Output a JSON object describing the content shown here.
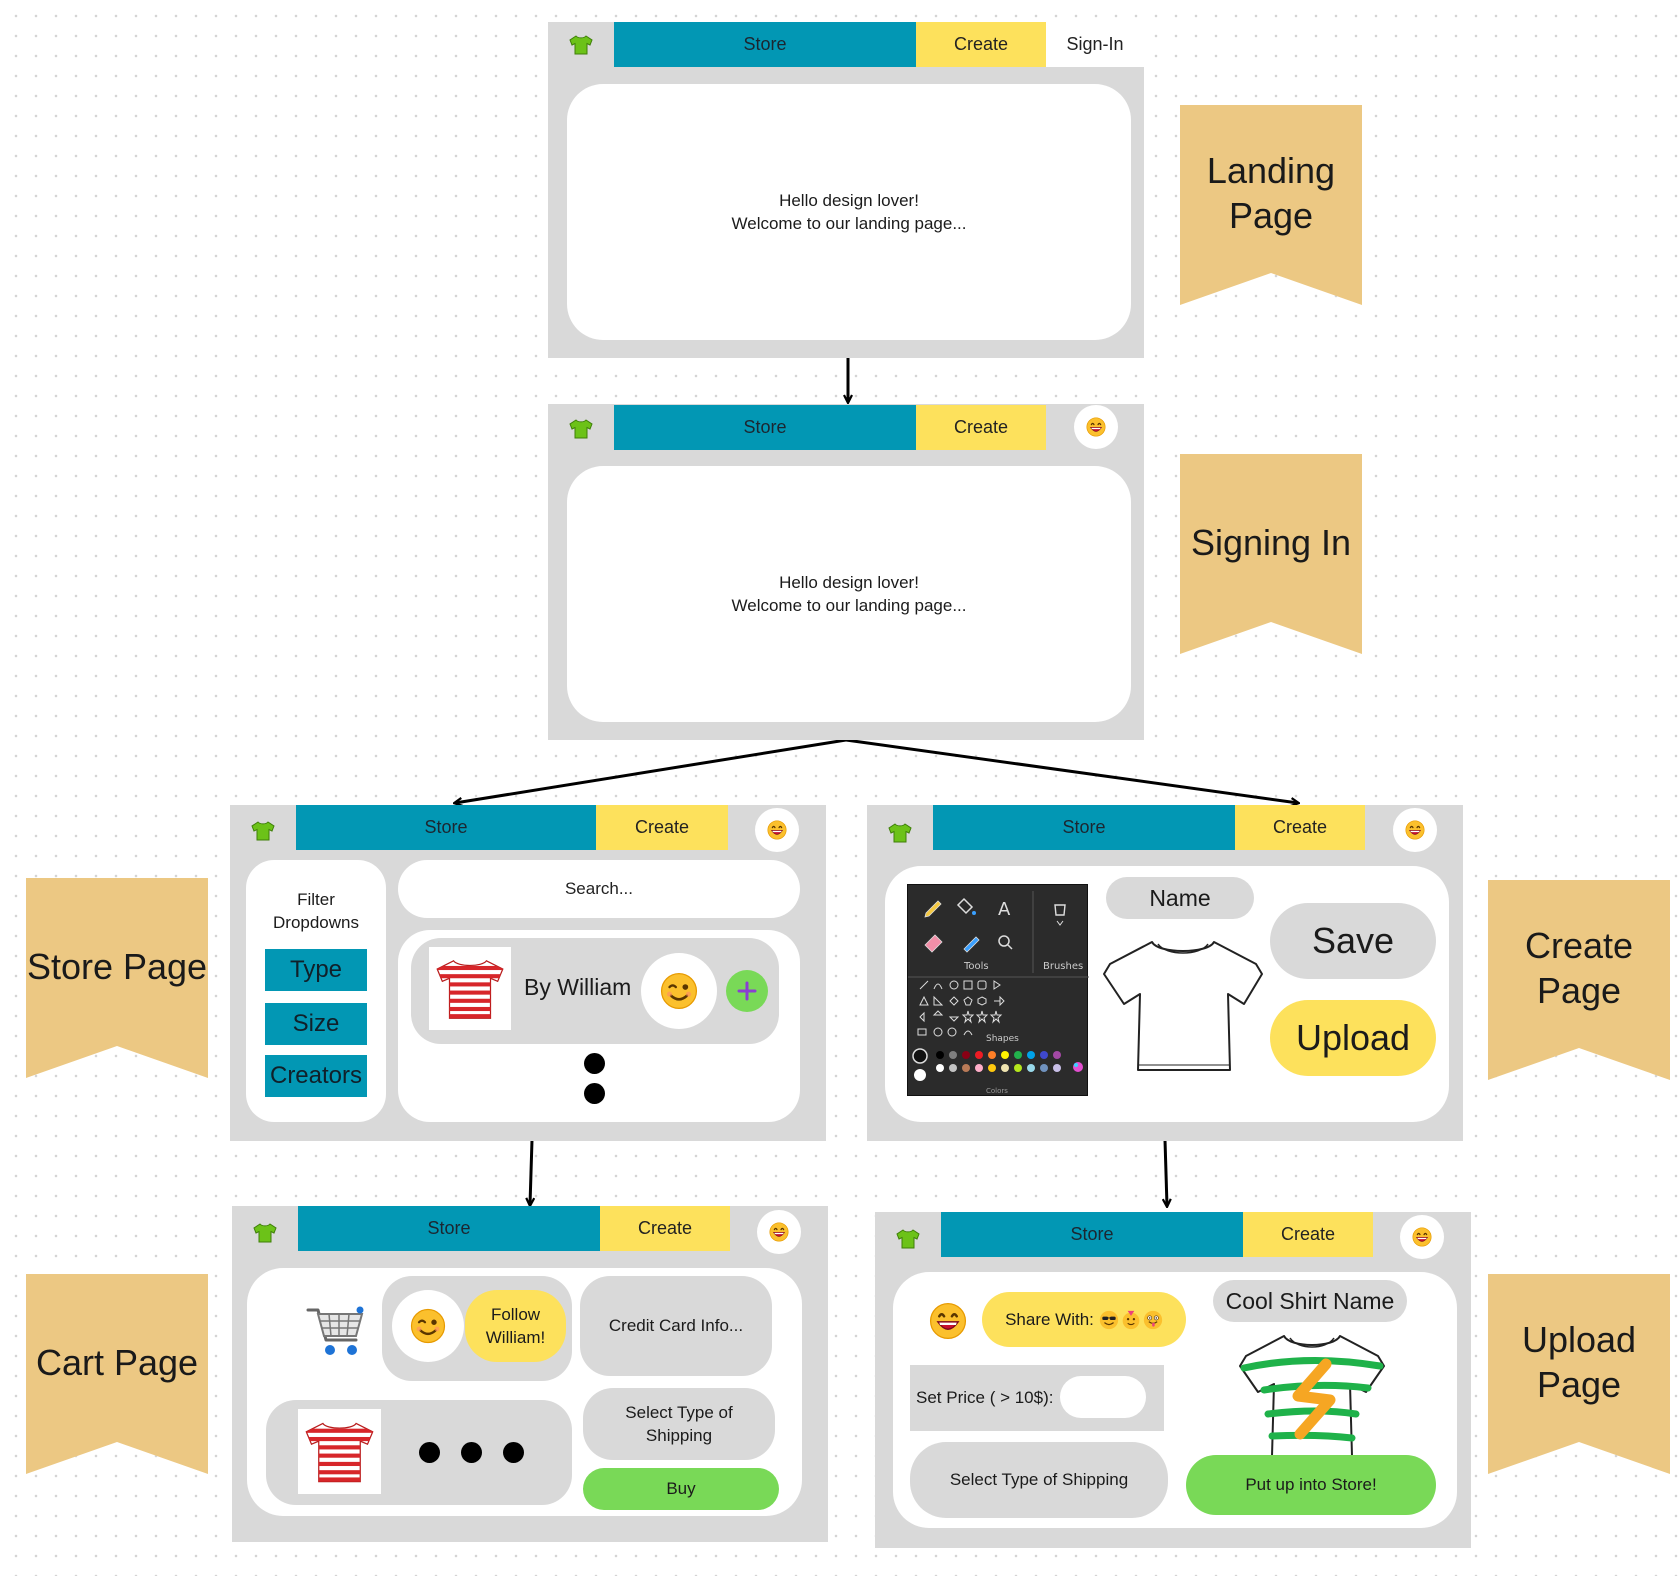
{
  "nav": {
    "store": "Store",
    "create": "Create",
    "sign_in": "Sign-In"
  },
  "landing": {
    "line1": "Hello design lover!",
    "line2": "Welcome to our landing page..."
  },
  "labels": {
    "landing": [
      "Landing",
      "Page"
    ],
    "signing_in": [
      "Signing In"
    ],
    "store": [
      "Store Page"
    ],
    "create": [
      "Create",
      "Page"
    ],
    "cart": [
      "Cart Page"
    ],
    "upload": [
      "Upload",
      "Page"
    ]
  },
  "store_page": {
    "filter_title": [
      "Filter",
      "Dropdowns"
    ],
    "filters": [
      "Type",
      "Size",
      "Creators"
    ],
    "search_placeholder": "Search...",
    "item_author": "By William"
  },
  "create_page": {
    "name": "Name",
    "save": "Save",
    "upload": "Upload",
    "paint_tools_label": "Tools",
    "paint_brushes_label": "Brushes",
    "paint_shapes_label": "Shapes",
    "paint_colors_label": "Colors"
  },
  "cart_page": {
    "follow": [
      "Follow",
      "William!"
    ],
    "credit_card": "Credit Card Info...",
    "shipping": [
      "Select Type of",
      "Shipping"
    ],
    "buy": "Buy"
  },
  "upload_page": {
    "share_with": "Share With:",
    "shirt_name": "Cool Shirt Name",
    "set_price": "Set Price ( > 10$):",
    "shipping": "Select Type of Shipping",
    "put_up": "Put up into Store!"
  },
  "colors": {
    "store_nav": "#0297b4",
    "create_nav": "#fde15c",
    "frame": "#d9d9d9",
    "ribbon": "#ecc883",
    "green_button": "#79d957",
    "yellow_button": "#fde15c"
  }
}
